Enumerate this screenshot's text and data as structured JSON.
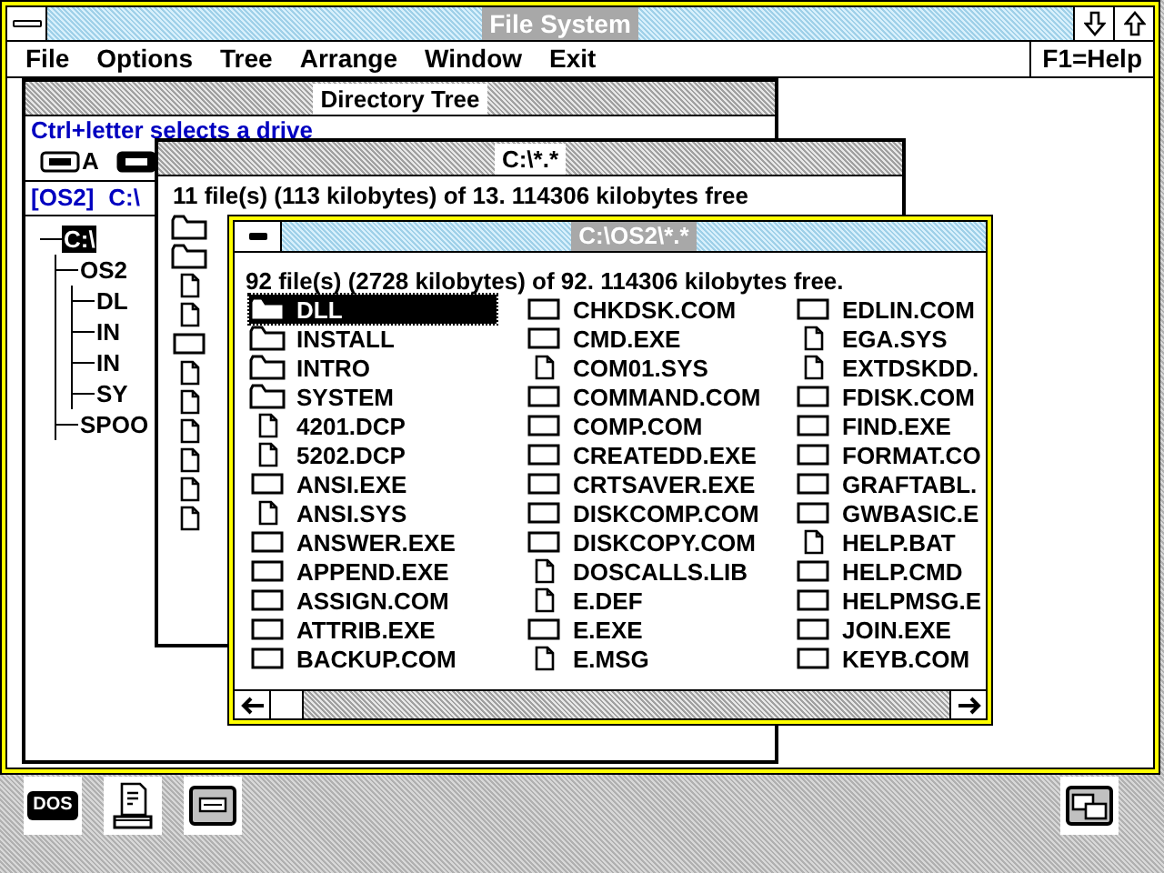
{
  "main_window": {
    "title": "File System",
    "menu": [
      "File",
      "Options",
      "Tree",
      "Arrange",
      "Window",
      "Exit"
    ],
    "help": "F1=Help"
  },
  "tree_window": {
    "title": "Directory Tree",
    "hint": "Ctrl+letter selects a drive",
    "drives": [
      {
        "label": "A",
        "selected": false
      },
      {
        "selected": true
      }
    ],
    "path": [
      "[OS2]",
      "C:\\"
    ],
    "tree": [
      {
        "label": "C:\\",
        "selected": true,
        "children": [
          {
            "label": "OS2",
            "selected": false,
            "children": [
              {
                "label": "DL",
                "selected": false
              },
              {
                "label": "IN",
                "selected": false
              },
              {
                "label": "IN",
                "selected": false
              },
              {
                "label": "SY",
                "selected": false
              }
            ]
          },
          {
            "label": "SPOO",
            "selected": false
          }
        ]
      }
    ]
  },
  "root_window": {
    "title": "C:\\*.*",
    "summary": "11 file(s) (113 kilobytes) of 13.  114306 kilobytes free",
    "items": [
      {
        "kind": "folder"
      },
      {
        "kind": "folder"
      },
      {
        "kind": "file"
      },
      {
        "kind": "file"
      },
      {
        "kind": "program"
      },
      {
        "kind": "file"
      },
      {
        "kind": "file"
      },
      {
        "kind": "file"
      },
      {
        "kind": "file"
      },
      {
        "kind": "file"
      },
      {
        "kind": "file"
      }
    ]
  },
  "os2_window": {
    "title": "C:\\OS2\\*.*",
    "summary": "92 file(s) (2728 kilobytes) of 92.  114306 kilobytes free.",
    "columns": [
      [
        {
          "name": "DLL",
          "kind": "folder",
          "selected": true
        },
        {
          "name": "INSTALL",
          "kind": "folder",
          "selected": false
        },
        {
          "name": "INTRO",
          "kind": "folder",
          "selected": false
        },
        {
          "name": "SYSTEM",
          "kind": "folder",
          "selected": false
        },
        {
          "name": "4201.DCP",
          "kind": "file",
          "selected": false
        },
        {
          "name": "5202.DCP",
          "kind": "file",
          "selected": false
        },
        {
          "name": "ANSI.EXE",
          "kind": "program",
          "selected": false
        },
        {
          "name": "ANSI.SYS",
          "kind": "file",
          "selected": false
        },
        {
          "name": "ANSWER.EXE",
          "kind": "program",
          "selected": false
        },
        {
          "name": "APPEND.EXE",
          "kind": "program",
          "selected": false
        },
        {
          "name": "ASSIGN.COM",
          "kind": "program",
          "selected": false
        },
        {
          "name": "ATTRIB.EXE",
          "kind": "program",
          "selected": false
        },
        {
          "name": "BACKUP.COM",
          "kind": "program",
          "selected": false
        }
      ],
      [
        {
          "name": "CHKDSK.COM",
          "kind": "program",
          "selected": false
        },
        {
          "name": "CMD.EXE",
          "kind": "program",
          "selected": false
        },
        {
          "name": "COM01.SYS",
          "kind": "file",
          "selected": false
        },
        {
          "name": "COMMAND.COM",
          "kind": "program",
          "selected": false
        },
        {
          "name": "COMP.COM",
          "kind": "program",
          "selected": false
        },
        {
          "name": "CREATEDD.EXE",
          "kind": "program",
          "selected": false
        },
        {
          "name": "CRTSAVER.EXE",
          "kind": "program",
          "selected": false
        },
        {
          "name": "DISKCOMP.COM",
          "kind": "program",
          "selected": false
        },
        {
          "name": "DISKCOPY.COM",
          "kind": "program",
          "selected": false
        },
        {
          "name": "DOSCALLS.LIB",
          "kind": "file",
          "selected": false
        },
        {
          "name": "E.DEF",
          "kind": "file",
          "selected": false
        },
        {
          "name": "E.EXE",
          "kind": "program",
          "selected": false
        },
        {
          "name": "E.MSG",
          "kind": "file",
          "selected": false
        }
      ],
      [
        {
          "name": "EDLIN.COM",
          "kind": "program",
          "selected": false
        },
        {
          "name": "EGA.SYS",
          "kind": "file",
          "selected": false
        },
        {
          "name": "EXTDSKDD.",
          "kind": "file",
          "selected": false
        },
        {
          "name": "FDISK.COM",
          "kind": "program",
          "selected": false
        },
        {
          "name": "FIND.EXE",
          "kind": "program",
          "selected": false
        },
        {
          "name": "FORMAT.CO",
          "kind": "program",
          "selected": false
        },
        {
          "name": "GRAFTABL.",
          "kind": "program",
          "selected": false
        },
        {
          "name": "GWBASIC.E",
          "kind": "program",
          "selected": false
        },
        {
          "name": "HELP.BAT",
          "kind": "file",
          "selected": false
        },
        {
          "name": "HELP.CMD",
          "kind": "program",
          "selected": false
        },
        {
          "name": "HELPMSG.E",
          "kind": "program",
          "selected": false
        },
        {
          "name": "JOIN.EXE",
          "kind": "program",
          "selected": false
        },
        {
          "name": "KEYB.COM",
          "kind": "program",
          "selected": false
        }
      ]
    ]
  },
  "desktop_icons": [
    {
      "kind": "dos",
      "label": "DOS"
    },
    {
      "kind": "print"
    },
    {
      "kind": "window"
    },
    {
      "kind": "switch"
    }
  ]
}
